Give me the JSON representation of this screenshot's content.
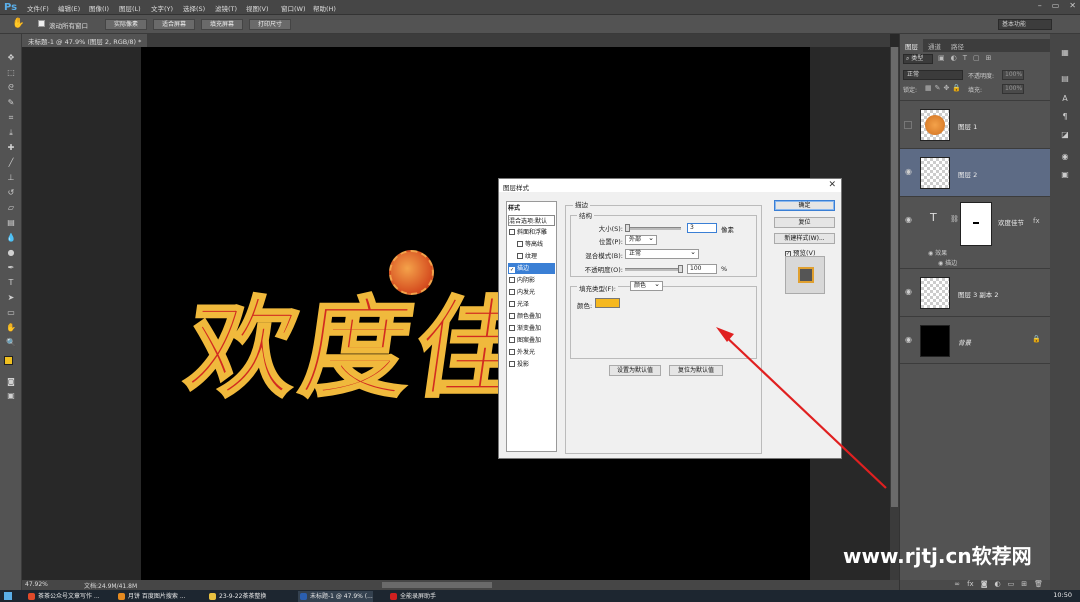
{
  "app": {
    "logo": "Ps"
  },
  "menu": [
    "文件(F)",
    "编辑(E)",
    "图像(I)",
    "图层(L)",
    "文字(Y)",
    "选择(S)",
    "滤镜(T)",
    "视图(V)",
    "窗口(W)",
    "帮助(H)"
  ],
  "window_controls": [
    "–",
    "▭",
    "✕"
  ],
  "options": {
    "scroll_all_label": "滚动所有窗口",
    "buttons": [
      "实际像素",
      "适合屏幕",
      "填充屏幕",
      "打印尺寸"
    ],
    "workspace": "基本功能"
  },
  "document": {
    "tab_title": "未标题-1 @ 47.9% (图层 2, RGB/8) *",
    "canvas_text": "欢度佳"
  },
  "status": {
    "zoom": "47.92%",
    "doc_size": "文档:24.9M/41.8M"
  },
  "taskbar": {
    "items": [
      {
        "label": "茶茶公众号文章写作 ...",
        "color": "#e04a2a"
      },
      {
        "label": "月饼 百度图片搜索 ...",
        "color": "#e58a20"
      },
      {
        "label": "23-9-22茶茶整换",
        "color": "#e8c040"
      },
      {
        "label": "未标题-1 @ 47.9% (...",
        "color": "#2b5fb0"
      },
      {
        "label": "全能录屏助手",
        "color": "#d02020"
      }
    ],
    "clock": "10:50"
  },
  "layers_panel": {
    "tabs": [
      "图层",
      "通道",
      "路径"
    ],
    "filter_label": "类型",
    "blend_mode": "正常",
    "opacity_label": "不透明度:",
    "opacity_value": "100%",
    "lock_label": "锁定:",
    "fill_label": "填充:",
    "fill_value": "100%",
    "layers": [
      {
        "name": "图层 1"
      },
      {
        "name": "图层 2"
      },
      {
        "name": "欢度佳节",
        "type_glyph": "T",
        "effects_label": "效果",
        "effect_item": "描边"
      },
      {
        "name": "图层 3 副本 2"
      },
      {
        "name": "背景"
      }
    ]
  },
  "dialog": {
    "title": "图层样式",
    "list_header": "样式",
    "list_items": [
      {
        "label": "混合选项:默认",
        "checkbox": false,
        "selected": false
      },
      {
        "label": "斜面和浮雕",
        "checkbox": true,
        "checked": false,
        "selected": false
      },
      {
        "label": "等高线",
        "checkbox": true,
        "checked": false,
        "selected": false,
        "indent": true
      },
      {
        "label": "纹理",
        "checkbox": true,
        "checked": false,
        "selected": false,
        "indent": true
      },
      {
        "label": "描边",
        "checkbox": true,
        "checked": true,
        "selected": true
      },
      {
        "label": "内阴影",
        "checkbox": true,
        "checked": false,
        "selected": false
      },
      {
        "label": "内发光",
        "checkbox": true,
        "checked": false,
        "selected": false
      },
      {
        "label": "光泽",
        "checkbox": true,
        "checked": false,
        "selected": false
      },
      {
        "label": "颜色叠加",
        "checkbox": true,
        "checked": false,
        "selected": false
      },
      {
        "label": "渐变叠加",
        "checkbox": true,
        "checked": false,
        "selected": false
      },
      {
        "label": "图案叠加",
        "checkbox": true,
        "checked": false,
        "selected": false
      },
      {
        "label": "外发光",
        "checkbox": true,
        "checked": false,
        "selected": false
      },
      {
        "label": "投影",
        "checkbox": true,
        "checked": false,
        "selected": false
      }
    ],
    "section_title": "描边",
    "structure_title": "结构",
    "size_label": "大小(S):",
    "size_value": "3",
    "size_unit": "像素",
    "position_label": "位置(P):",
    "position_value": "外部",
    "blend_label": "混合模式(B):",
    "blend_value": "正常",
    "opacity_label": "不透明度(O):",
    "opacity_value": "100",
    "opacity_unit": "%",
    "fill_type_label": "填充类型(F):",
    "fill_type_value": "颜色",
    "color_label": "颜色:",
    "stroke_color": "#f5b820",
    "set_default": "设置为默认值",
    "reset_default": "复位为默认值",
    "ok": "确定",
    "cancel": "复位",
    "new_style": "新建样式(W)...",
    "preview_label": "预览(V)"
  },
  "watermark": "www.rjtj.cn软荐网",
  "colors": {
    "foreground": "#f0c020",
    "background": "#e09020",
    "accent": "#3a7fd5"
  }
}
